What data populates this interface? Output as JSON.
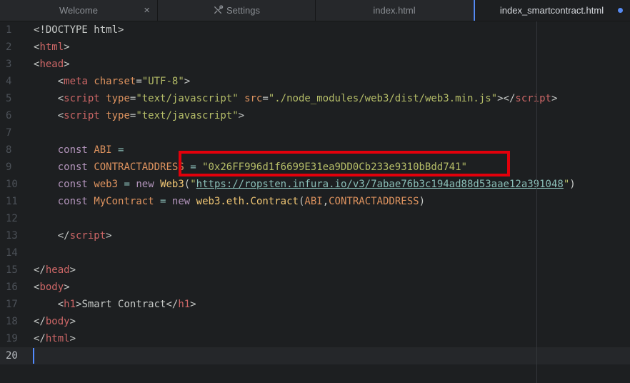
{
  "tabs": [
    {
      "label": "Welcome",
      "active": false,
      "has_close": true
    },
    {
      "label": "Settings",
      "active": false,
      "icon": "tools-icon"
    },
    {
      "label": "index.html",
      "active": false
    },
    {
      "label": "index_smartcontract.html",
      "active": true,
      "modified": true
    }
  ],
  "tab_close_glyph": "×",
  "lines": [
    {
      "n": "1",
      "tokens": [
        [
          "plain",
          "<!DOCTYPE html>"
        ]
      ]
    },
    {
      "n": "2",
      "tokens": [
        [
          "plain",
          "<"
        ],
        [
          "tag",
          "html"
        ],
        [
          "plain",
          ">"
        ]
      ]
    },
    {
      "n": "3",
      "tokens": [
        [
          "plain",
          "<"
        ],
        [
          "tag",
          "head"
        ],
        [
          "plain",
          ">"
        ]
      ]
    },
    {
      "n": "4",
      "tokens": [
        [
          "plain",
          "    <"
        ],
        [
          "tag",
          "meta"
        ],
        [
          "plain",
          " "
        ],
        [
          "attr",
          "charset"
        ],
        [
          "plain",
          "="
        ],
        [
          "str",
          "\"UTF-8\""
        ],
        [
          "plain",
          ">"
        ]
      ]
    },
    {
      "n": "5",
      "tokens": [
        [
          "plain",
          "    <"
        ],
        [
          "tag",
          "script"
        ],
        [
          "plain",
          " "
        ],
        [
          "attr",
          "type"
        ],
        [
          "plain",
          "="
        ],
        [
          "str",
          "\"text/javascript\""
        ],
        [
          "plain",
          " "
        ],
        [
          "attr",
          "src"
        ],
        [
          "plain",
          "="
        ],
        [
          "str",
          "\"./node_modules/web3/dist/web3.min.js\""
        ],
        [
          "plain",
          "></"
        ],
        [
          "tag",
          "script"
        ],
        [
          "plain",
          ">"
        ]
      ]
    },
    {
      "n": "6",
      "tokens": [
        [
          "plain",
          "    <"
        ],
        [
          "tag",
          "script"
        ],
        [
          "plain",
          " "
        ],
        [
          "attr",
          "type"
        ],
        [
          "plain",
          "="
        ],
        [
          "str",
          "\"text/javascript\""
        ],
        [
          "plain",
          ">"
        ]
      ]
    },
    {
      "n": "7",
      "tokens": []
    },
    {
      "n": "8",
      "tokens": [
        [
          "plain",
          "    "
        ],
        [
          "kw",
          "const"
        ],
        [
          "plain",
          " "
        ],
        [
          "var",
          "ABI"
        ],
        [
          "plain",
          " "
        ],
        [
          "op",
          "="
        ]
      ]
    },
    {
      "n": "9",
      "tokens": [
        [
          "plain",
          "    "
        ],
        [
          "kw",
          "const"
        ],
        [
          "plain",
          " "
        ],
        [
          "var",
          "CONTRACTADDRESS"
        ],
        [
          "plain",
          " "
        ],
        [
          "op",
          "="
        ],
        [
          "plain",
          " "
        ],
        [
          "str",
          "\"0x26FF996d1f6699E31ea9DD0Cb233e9310bBdd741\""
        ]
      ]
    },
    {
      "n": "10",
      "tokens": [
        [
          "plain",
          "    "
        ],
        [
          "kw",
          "const"
        ],
        [
          "plain",
          " "
        ],
        [
          "var",
          "web3"
        ],
        [
          "plain",
          " "
        ],
        [
          "op",
          "="
        ],
        [
          "plain",
          " "
        ],
        [
          "kw",
          "new"
        ],
        [
          "plain",
          " "
        ],
        [
          "fn",
          "Web3"
        ],
        [
          "plain",
          "("
        ],
        [
          "str",
          "\""
        ],
        [
          "lnk",
          "https://ropsten.infura.io/v3/7abae76b3c194ad88d53aae12a391048"
        ],
        [
          "str",
          "\""
        ],
        [
          "plain",
          ")"
        ]
      ]
    },
    {
      "n": "11",
      "tokens": [
        [
          "plain",
          "    "
        ],
        [
          "kw",
          "const"
        ],
        [
          "plain",
          " "
        ],
        [
          "var",
          "MyContract"
        ],
        [
          "plain",
          " "
        ],
        [
          "op",
          "="
        ],
        [
          "plain",
          " "
        ],
        [
          "kw",
          "new"
        ],
        [
          "plain",
          " "
        ],
        [
          "fn",
          "web3.eth.Contract"
        ],
        [
          "plain",
          "("
        ],
        [
          "var",
          "ABI"
        ],
        [
          "plain",
          ","
        ],
        [
          "var",
          "CONTRACTADDRESS"
        ],
        [
          "plain",
          ")"
        ]
      ]
    },
    {
      "n": "12",
      "tokens": []
    },
    {
      "n": "13",
      "tokens": [
        [
          "plain",
          "    </"
        ],
        [
          "tag",
          "script"
        ],
        [
          "plain",
          ">"
        ]
      ]
    },
    {
      "n": "14",
      "tokens": []
    },
    {
      "n": "15",
      "tokens": [
        [
          "plain",
          "</"
        ],
        [
          "tag",
          "head"
        ],
        [
          "plain",
          ">"
        ]
      ]
    },
    {
      "n": "16",
      "tokens": [
        [
          "plain",
          "<"
        ],
        [
          "tag",
          "body"
        ],
        [
          "plain",
          ">"
        ]
      ]
    },
    {
      "n": "17",
      "tokens": [
        [
          "plain",
          "    <"
        ],
        [
          "tag",
          "h1"
        ],
        [
          "plain",
          ">Smart Contract</"
        ],
        [
          "tag",
          "h1"
        ],
        [
          "plain",
          ">"
        ]
      ]
    },
    {
      "n": "18",
      "tokens": [
        [
          "plain",
          "</"
        ],
        [
          "tag",
          "body"
        ],
        [
          "plain",
          ">"
        ]
      ]
    },
    {
      "n": "19",
      "tokens": [
        [
          "plain",
          "</"
        ],
        [
          "tag",
          "html"
        ],
        [
          "plain",
          ">"
        ]
      ]
    },
    {
      "n": "20",
      "tokens": [],
      "current": true
    }
  ]
}
